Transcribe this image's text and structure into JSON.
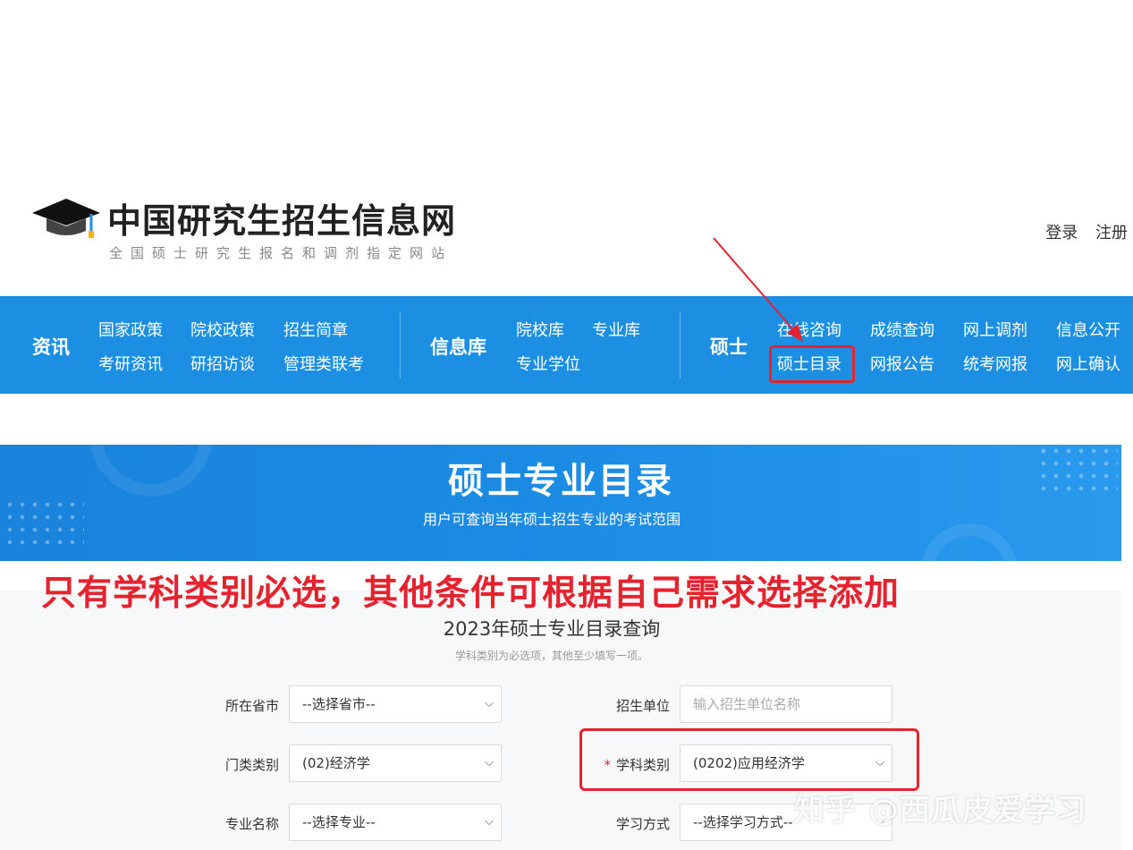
{
  "header": {
    "title": "中国研究生招生信息网",
    "subtitle": "全国硕士研究生报名和调剂指定网站",
    "login": "登录",
    "register": "注册"
  },
  "nav": {
    "groups": [
      {
        "title": "资讯",
        "links": [
          "国家政策",
          "院校政策",
          "招生简章",
          "考研资讯",
          "研招访谈",
          "管理类联考"
        ]
      },
      {
        "title": "信息库",
        "links": [
          "院校库",
          "专业库",
          "专业学位"
        ]
      },
      {
        "title": "硕士",
        "links": [
          "在线咨询",
          "成绩查询",
          "网上调剂",
          "信息公开",
          "硕士目录",
          "网报公告",
          "统考网报",
          "网上确认"
        ]
      }
    ]
  },
  "banner": {
    "title": "硕士专业目录",
    "subtitle": "用户可查询当年硕士招生专业的考试范围"
  },
  "annotation": "只有学科类别必选，其他条件可根据自己需求选择添加",
  "form": {
    "title": "2023年硕士专业目录查询",
    "hint": "学科类别为必选项，其他至少填写一项。",
    "fields": {
      "province": {
        "label": "所在省市",
        "value": "--选择省市--"
      },
      "unit": {
        "label": "招生单位",
        "placeholder": "输入招生单位名称"
      },
      "category": {
        "label": "门类类别",
        "value": "(02)经济学"
      },
      "discipline": {
        "label": "学科类别",
        "value": "(0202)应用经济学",
        "required_mark": "*"
      },
      "major": {
        "label": "专业名称",
        "value": "--选择专业--"
      },
      "study_mode": {
        "label": "学习方式",
        "value": "--选择学习方式--"
      }
    }
  },
  "watermark": "知乎 @西瓜皮爱学习",
  "colors": {
    "nav_blue": "#1c8fe3",
    "highlight_red": "#e5232f"
  }
}
